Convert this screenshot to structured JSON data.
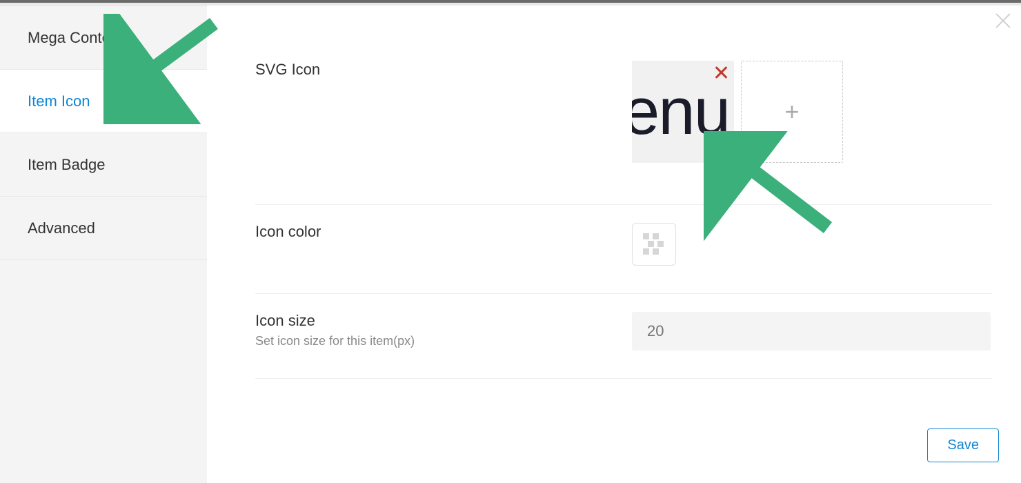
{
  "sidebar": {
    "items": [
      {
        "label": "Mega Content"
      },
      {
        "label": "Item Icon"
      },
      {
        "label": "Item Badge"
      },
      {
        "label": "Advanced"
      }
    ],
    "active_index": 1
  },
  "svg_icon": {
    "label": "SVG Icon",
    "preview_text": "enu",
    "remove_icon": "close-icon",
    "add_icon": "plus-icon"
  },
  "icon_color": {
    "label": "Icon color",
    "value": null,
    "picker_icon": "transparent-swatch"
  },
  "icon_size": {
    "label": "Icon size",
    "hint": "Set icon size for this item(px)",
    "value": "",
    "placeholder": "20"
  },
  "actions": {
    "save_label": "Save",
    "close_icon": "close-icon"
  },
  "annotations": {
    "arrow_color": "#3bb07a"
  }
}
